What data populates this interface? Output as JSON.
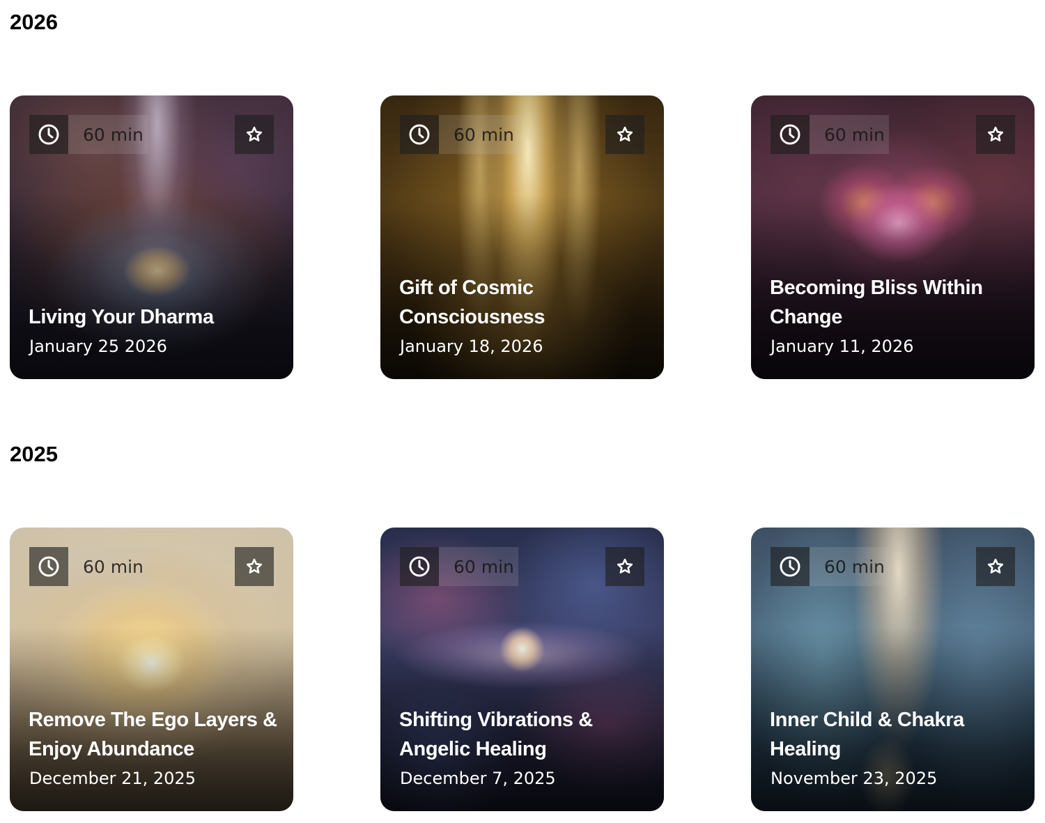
{
  "sections": [
    {
      "year": "2026",
      "cards": [
        {
          "duration": "60 min",
          "title": "Living Your Dharma",
          "date": "January 25 2026"
        },
        {
          "duration": "60 min",
          "title": "Gift of Cosmic Consciousness",
          "date": "January 18, 2026"
        },
        {
          "duration": "60 min",
          "title": "Becoming Bliss Within Change",
          "date": "January 11, 2026"
        }
      ]
    },
    {
      "year": "2025",
      "cards": [
        {
          "duration": "60 min",
          "title": "Remove The Ego Layers & Enjoy Abundance",
          "date": "December 21, 2025"
        },
        {
          "duration": "60 min",
          "title": "Shifting Vibrations & Angelic Healing",
          "date": "December 7, 2025"
        },
        {
          "duration": "60 min",
          "title": "Inner Child & Chakra Healing",
          "date": "November 23, 2025"
        }
      ]
    }
  ],
  "icons": {
    "duration": "clock-icon",
    "favorite": "star-icon"
  },
  "colors": {
    "heading_text": "#000000",
    "card_text": "#ffffff",
    "icon_box": "#1e1e1e"
  }
}
